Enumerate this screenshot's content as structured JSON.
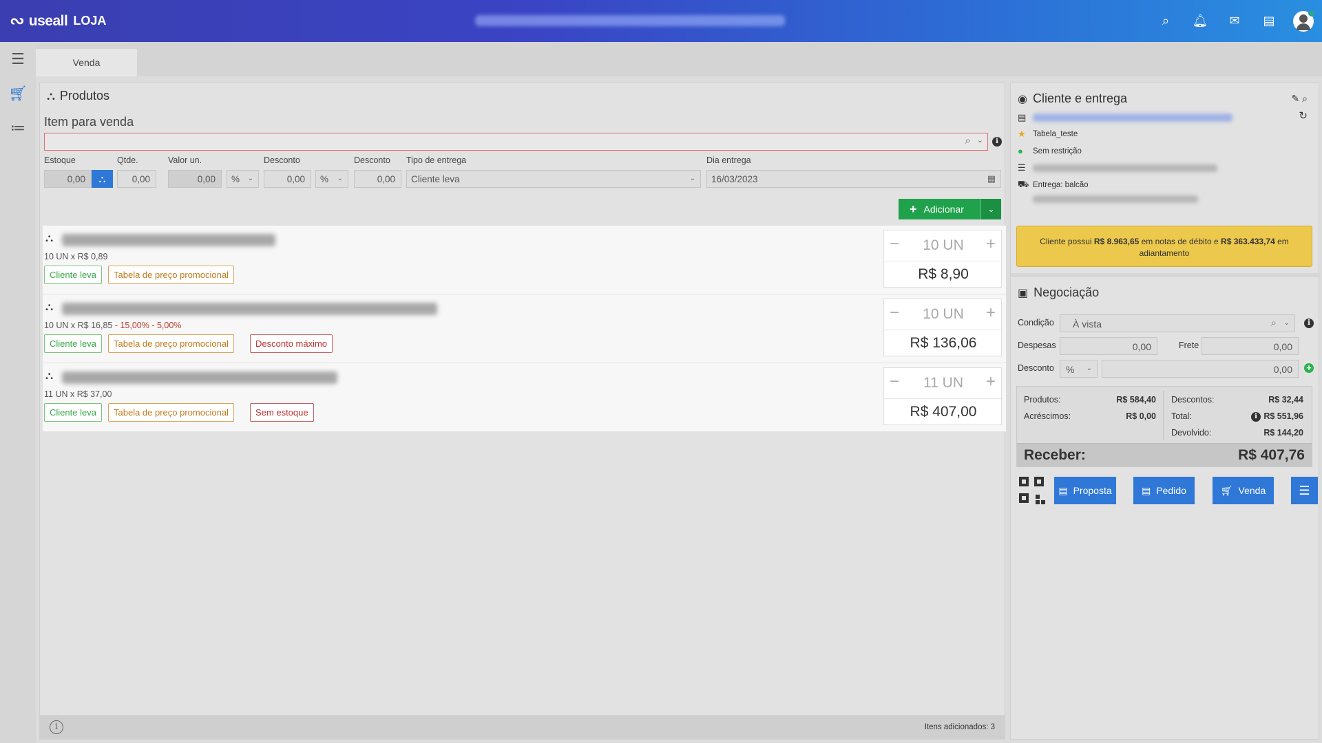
{
  "header": {
    "brand": "useall",
    "store": "LOJA",
    "icons": [
      "search-icon",
      "bell-icon",
      "mail-icon",
      "chat-icon",
      "avatar"
    ]
  },
  "nav": {
    "icons": [
      "menu-icon",
      "cart-icon",
      "list-icon"
    ]
  },
  "tabs": [
    {
      "label": "Venda"
    }
  ],
  "products": {
    "title": "Produtos",
    "item_label": "Item para venda",
    "fields": {
      "estoque_label": "Estoque",
      "estoque_value": "0,00",
      "qtde_label": "Qtde.",
      "qtde_value": "0,00",
      "valor_label": "Valor un.",
      "valor_value": "0,00",
      "desconto1_label": "Desconto",
      "desconto1_type": "%",
      "desconto1_value": "0,00",
      "desconto2_label": "Desconto",
      "desconto2_type": "%",
      "desconto2_value": "0,00",
      "entrega_label": "Tipo de entrega",
      "entrega_value": "Cliente leva",
      "dia_label": "Dia entrega",
      "dia_value": "16/03/2023"
    },
    "add_button": "Adicionar",
    "items": [
      {
        "meta": "10 UN x R$ 0,89",
        "discount": "",
        "tags": [
          "Cliente leva",
          "Tabela de preço promocional"
        ],
        "qty": "10 UN",
        "price": "R$ 8,90"
      },
      {
        "meta": "10 UN x R$ 16,85",
        "discount": " - 15,00% - 5,00%",
        "tags": [
          "Cliente leva",
          "Tabela de preço promocional",
          "Desconto máximo"
        ],
        "qty": "10 UN",
        "price": "R$ 136,06"
      },
      {
        "meta": "11 UN x R$ 37,00",
        "discount": "",
        "tags": [
          "Cliente leva",
          "Tabela de preço promocional",
          "Sem estoque"
        ],
        "qty": "11 UN",
        "price": "R$ 407,00"
      }
    ],
    "footer_count": "Itens adicionados: 3"
  },
  "client": {
    "title": "Cliente e entrega",
    "tabela": "Tabela_teste",
    "restricao": "Sem restrição",
    "entrega": "Entrega: balcão",
    "notice_pre": "Cliente possui ",
    "notice_debito": "R$ 8.963,65",
    "notice_mid": " em notas de débito e ",
    "notice_adiant": "R$ 363.433,74",
    "notice_post": " em adiantamento"
  },
  "negotiation": {
    "title": "Negociação",
    "condicao_label": "Condição",
    "condicao_value": "À vista",
    "despesas_label": "Despesas",
    "despesas_value": "0,00",
    "frete_label": "Frete",
    "frete_value": "0,00",
    "desconto_label": "Desconto",
    "desconto_type": "%",
    "desconto_value": "0,00",
    "totals": {
      "produtos_label": "Produtos:",
      "produtos_value": "R$ 584,40",
      "acrescimos_label": "Acréscimos:",
      "acrescimos_value": "R$ 0,00",
      "descontos_label": "Descontos:",
      "descontos_value": "R$ 32,44",
      "total_label": "Total:",
      "total_value": "R$ 551,96",
      "devolvido_label": "Devolvido:",
      "devolvido_value": "R$ 144,20",
      "receber_label": "Receber:",
      "receber_value": "R$ 407,76"
    },
    "buttons": {
      "proposta": "Proposta",
      "pedido": "Pedido",
      "venda": "Venda"
    }
  }
}
